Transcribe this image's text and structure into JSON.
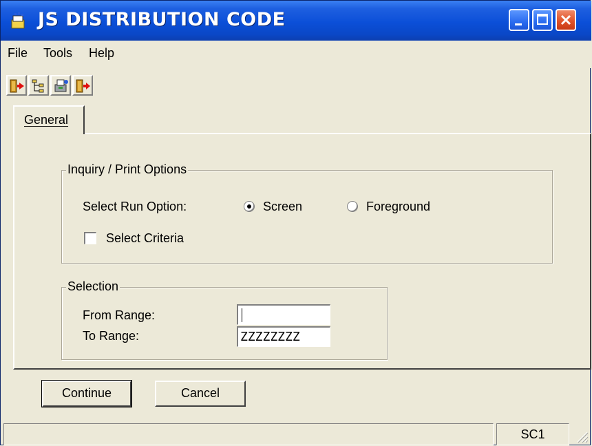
{
  "window": {
    "title": "JS DISTRIBUTION CODE",
    "controls": [
      "minimize",
      "maximize",
      "close"
    ]
  },
  "menu": {
    "items": [
      "File",
      "Tools",
      "Help"
    ]
  },
  "toolbar": {
    "icons": [
      "exit-door-icon",
      "tree-structure-icon",
      "print-setup-icon",
      "run-door-icon"
    ]
  },
  "tabs": [
    {
      "label": "General",
      "active": true
    }
  ],
  "inquiry_options": {
    "legend": "Inquiry / Print Options",
    "run_option_label": "Select Run Option:",
    "radio_options": [
      {
        "label": "Screen",
        "selected": true
      },
      {
        "label": "Foreground",
        "selected": false
      }
    ],
    "select_criteria_label": "Select Criteria",
    "select_criteria_checked": false
  },
  "selection": {
    "legend": "Selection",
    "from_label": "From Range:",
    "from_value": "",
    "to_label": "To Range:",
    "to_value": "ZZZZZZZZ"
  },
  "buttons": {
    "continue_label": "Continue",
    "cancel_label": "Cancel"
  },
  "status": {
    "left_text": "",
    "right_text": "SC1"
  }
}
